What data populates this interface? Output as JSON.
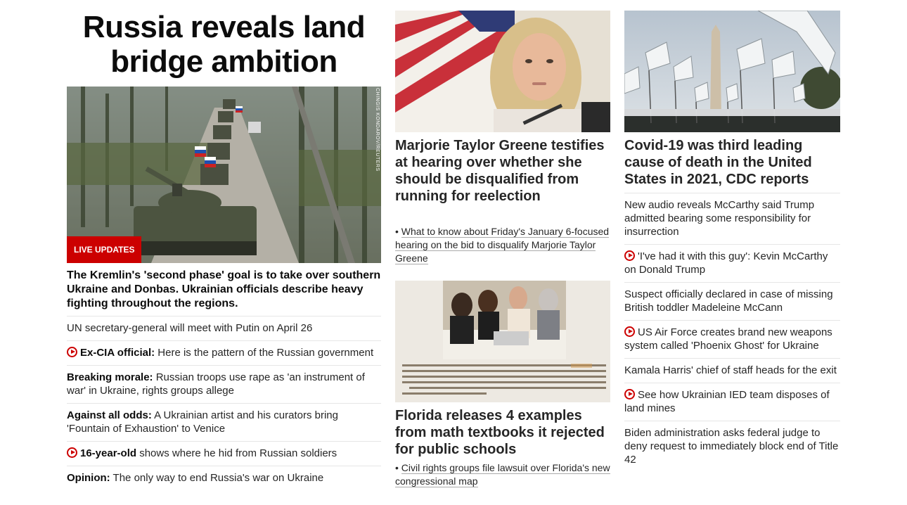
{
  "lead": {
    "headline": "Russia reveals land bridge ambition",
    "badge": "LIVE UPDATES",
    "photo_credit": "CHINGIS KONDAROV/REUTERS",
    "summary": "The Kremlin's 'second phase' goal is to take over southern Ukraine and Donbas. Ukrainian officials describe heavy fighting throughout the regions.",
    "items": [
      {
        "prefix": "",
        "text": "UN secretary-general will meet with Putin on April 26",
        "video": false
      },
      {
        "prefix": "Ex-CIA official:",
        "text": " Here is the pattern of the Russian government",
        "video": true
      },
      {
        "prefix": "Breaking morale:",
        "text": " Russian troops use rape as 'an instrument of war' in Ukraine, rights groups allege",
        "video": false
      },
      {
        "prefix": "Against all odds:",
        "text": " A Ukrainian artist and his curators bring 'Fountain of Exhaustion' to Venice",
        "video": false
      },
      {
        "prefix": "16-year-old",
        "text": " shows where he hid from Russian soldiers",
        "video": true
      },
      {
        "prefix": "Opinion:",
        "text": " The only way to end Russia's war on Ukraine",
        "video": false
      }
    ]
  },
  "mtg": {
    "title": "Marjorie Taylor Greene testifies at hearing over whether she should be disqualified from running for reelection",
    "sub": "What to know about Friday's January 6-focused hearing on the bid to disqualify Marjorie Taylor Greene"
  },
  "florida": {
    "title": "Florida releases 4 examples from math textbooks it rejected for public schools",
    "sub": "Civil rights groups file lawsuit over Florida's new congressional map",
    "image_text": "What? Me? Racist? More than 2 million people have tested their racial prejudice using an online version of the Implicit Association Test. Most groups' average scores fall between \"slight\" and \"moderate\" bias, but the differences among groups, by age and by political identification, are intriguing. In this section's Exercise Set (Exercises 103 and 104), you will be working with models that measure bias:"
  },
  "covid": {
    "title": "Covid-19 was third leading cause of death in the United States in 2021, CDC reports",
    "items": [
      {
        "text": "New audio reveals McCarthy said Trump admitted bearing some responsibility for insurrection",
        "video": false
      },
      {
        "text": "'I've had it with this guy': Kevin McCarthy on Donald Trump",
        "video": true
      },
      {
        "text": "Suspect officially declared in case of missing British toddler Madeleine McCann",
        "video": false
      },
      {
        "text": "US Air Force creates brand new weapons system called 'Phoenix Ghost' for Ukraine",
        "video": true
      },
      {
        "text": "Kamala Harris' chief of staff heads for the exit",
        "video": false
      },
      {
        "text": "See how Ukrainian IED team disposes of land mines",
        "video": true
      },
      {
        "text": "Biden administration asks federal judge to deny request to immediately block end of Title 42",
        "video": false
      }
    ]
  }
}
